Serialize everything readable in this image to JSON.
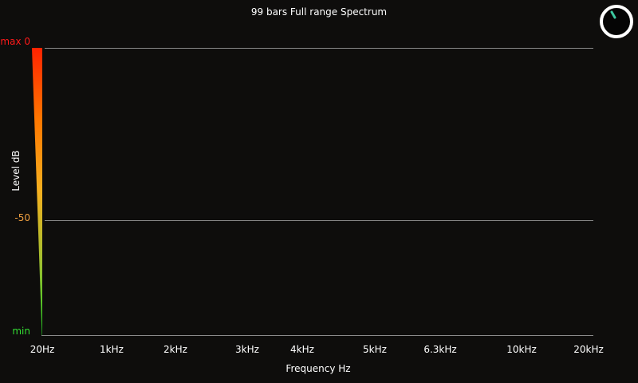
{
  "title": "99 bars Full range Spectrum",
  "y_axis": {
    "title": "Level dB",
    "labels": [
      {
        "text": "max 0",
        "color": "#ff1a1a"
      },
      {
        "text": "-50",
        "color": "#f0a040"
      },
      {
        "text": "min",
        "color": "#33dd33"
      }
    ]
  },
  "x_axis": {
    "title": "Frequency Hz",
    "ticks": [
      "20Hz",
      "1kHz",
      "2kHz",
      "3kHz",
      "4kHz",
      "5kHz",
      "6.3kHz",
      "10kHz",
      "20kHz"
    ]
  },
  "meter": {
    "colors": [
      "#ff2200",
      "#ff7700",
      "#f5b020",
      "#9ec030",
      "#22cc22"
    ]
  },
  "dial": {
    "icon": "dial-icon",
    "ring_color": "#ffffff",
    "indicator_color": "#3cc8a0"
  },
  "colors": {
    "background": "#0e0d0c",
    "gridline": "#8a8a8a"
  }
}
